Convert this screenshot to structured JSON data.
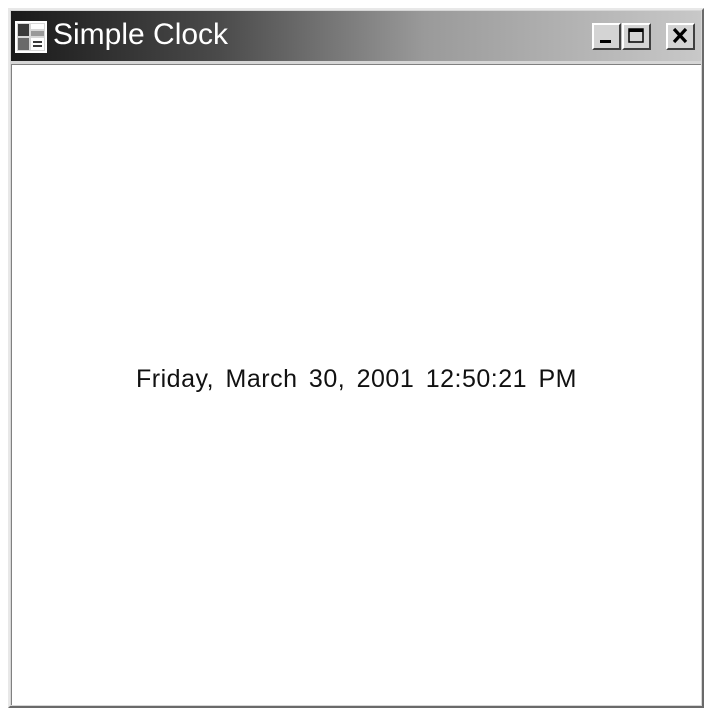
{
  "window": {
    "title": "Simple Clock",
    "app_icon": "app-window-icon",
    "controls": {
      "minimize_icon": "minimize-icon",
      "maximize_icon": "maximize-icon",
      "close_icon": "close-icon"
    }
  },
  "clock": {
    "display": "Friday, March 30, 2001 12:50:21 PM"
  },
  "colors": {
    "title_gradient_start": "#1a1a1a",
    "title_gradient_end": "#c8c8c8",
    "client_background": "#ffffff",
    "text": "#111111"
  }
}
